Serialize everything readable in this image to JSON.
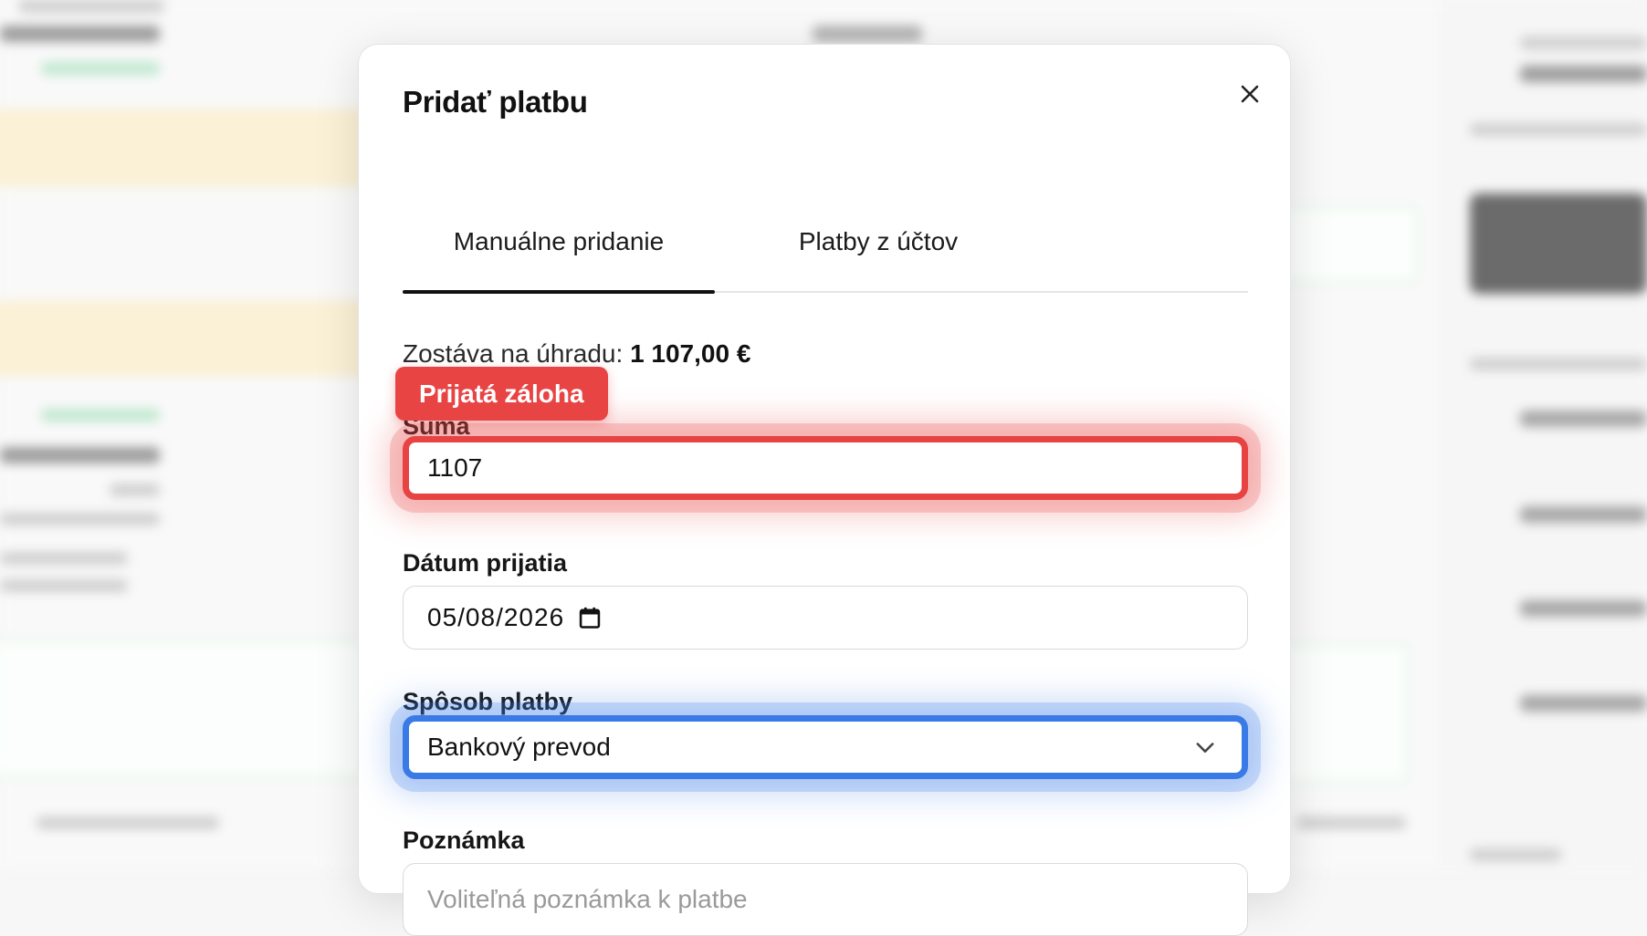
{
  "modal": {
    "title": "Pridať platbu",
    "close_icon": "close-icon"
  },
  "tabs": [
    {
      "label": "Manuálne pridanie",
      "active": true
    },
    {
      "label": "Platby z účtov",
      "active": false
    }
  ],
  "remaining": {
    "label": "Zostáva na úhradu:",
    "amount": "1 107,00 €"
  },
  "badge": {
    "label": "Prijatá záloha",
    "color": "#e94444"
  },
  "fields": {
    "amount": {
      "label": "Suma",
      "value": "1107",
      "highlight": "#e84343"
    },
    "date": {
      "label": "Dátum prijatia",
      "value": "05/08/2026",
      "icon": "calendar-icon"
    },
    "method": {
      "label": "Spôsob platby",
      "value": "Bankový prevod",
      "icon": "chevron-down-icon",
      "highlight": "#3a7ae6"
    },
    "note": {
      "label": "Poznámka",
      "placeholder": "Voliteľná poznámka k platbe"
    }
  }
}
